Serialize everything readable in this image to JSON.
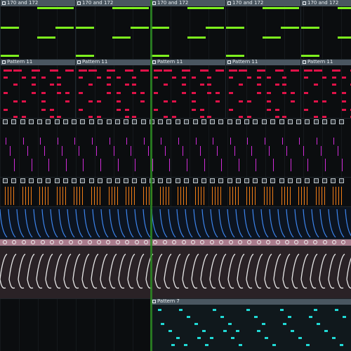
{
  "playlist": {
    "clips_row1_label": "170 and 172",
    "clips_row2_label": "Pattern 11",
    "clips_row8_label": "Pattern 7"
  },
  "colors": {
    "background": "#0b0d0f",
    "clip_header": "#4a5660",
    "green_notes": "#7df01e",
    "red_notes": "#e01248",
    "magenta_notes": "#d02cd8",
    "orange_notes": "#f07e18",
    "blue_waves": "#3d86f0",
    "pink_band": "#a87b8c",
    "white_waves": "#e8e8e8",
    "cyan_notes": "#20d8d4",
    "playhead": "#2c8a22"
  }
}
